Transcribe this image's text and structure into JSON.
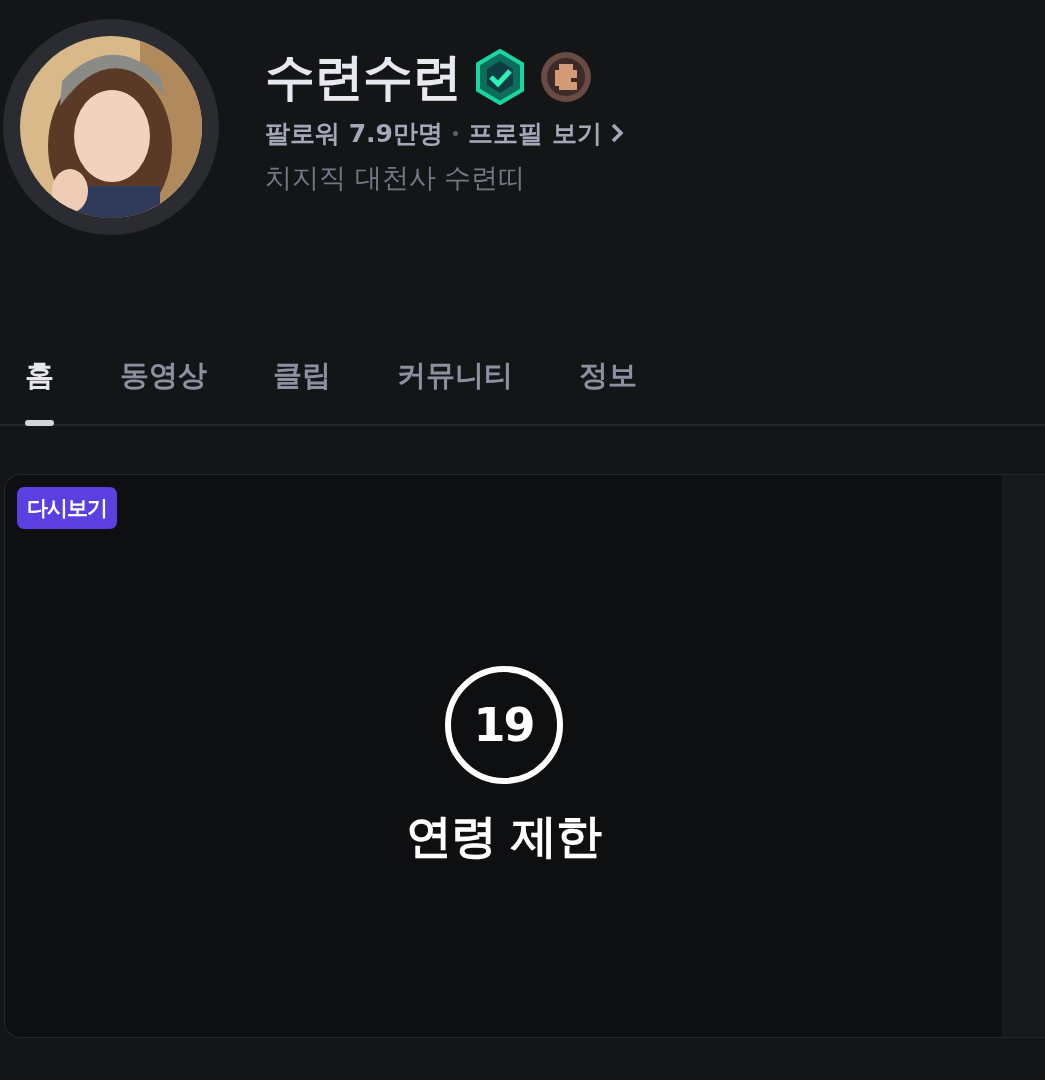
{
  "channel": {
    "name": "수련수련",
    "verified": true,
    "followers": "팔로워 7.9만명",
    "profile_link": "프로필 보기",
    "description": "치지직 대천사 수련띠"
  },
  "tabs": [
    {
      "label": "홈",
      "selected": true
    },
    {
      "label": "동영상",
      "selected": false
    },
    {
      "label": "클립",
      "selected": false
    },
    {
      "label": "커뮤니티",
      "selected": false
    },
    {
      "label": "정보",
      "selected": false
    }
  ],
  "video": {
    "badge": "다시보기",
    "age_mark": "19",
    "restriction": "연령 제한"
  }
}
